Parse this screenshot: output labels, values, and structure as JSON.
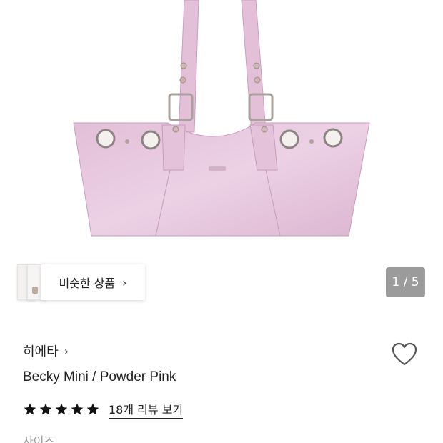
{
  "product_image": {
    "alt": "Becky Mini bag in Powder Pink",
    "color": "#e7c6de"
  },
  "similar": {
    "label": "비슷한 상품",
    "chevron": "chevron-right-icon"
  },
  "gallery": {
    "counter": "1 / 5"
  },
  "brand": {
    "name": "히에타",
    "chevron": "chevron-right-icon"
  },
  "product": {
    "title": "Becky Mini / Powder Pink"
  },
  "rating": {
    "stars": 5,
    "max": 5,
    "review_link": "18개 리뷰 보기"
  },
  "options": {
    "size_label": "사이즈"
  },
  "colors": {
    "star": "#111111",
    "counter_bg": "#9b9b9b",
    "bag_pink": "#e7c6de"
  },
  "icons": {
    "wishlist": "heart-outline-icon",
    "star": "star-icon"
  }
}
